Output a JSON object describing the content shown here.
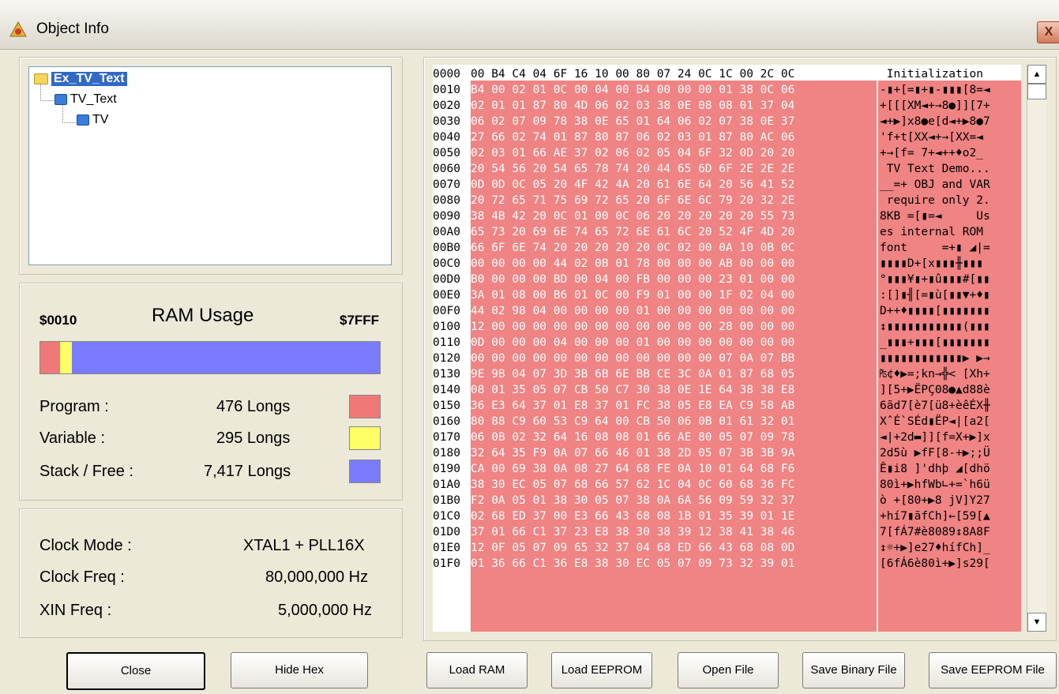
{
  "window": {
    "title": "Object Info",
    "close_glyph": "X"
  },
  "tree": {
    "items": [
      "Ex_TV_Text",
      "TV_Text",
      "TV"
    ]
  },
  "ram": {
    "low": "$0010",
    "title": "RAM Usage",
    "high": "$7FFF",
    "rows": [
      {
        "label": "Program :",
        "value": "476 Longs",
        "color": "#f07878"
      },
      {
        "label": "Variable :",
        "value": "295 Longs",
        "color": "#ffff66"
      },
      {
        "label": "Stack / Free :",
        "value": "7,417 Longs",
        "color": "#7b7bff"
      }
    ],
    "bar_segments": [
      {
        "name": "program",
        "longs": 476,
        "color": "#f07878"
      },
      {
        "name": "variable",
        "longs": 295,
        "color": "#ffff66"
      },
      {
        "name": "stack-free",
        "longs": 7417,
        "color": "#7b7bff"
      }
    ]
  },
  "clock": {
    "rows": [
      {
        "label": "Clock Mode :",
        "value": "XTAL1 + PLL16X"
      },
      {
        "label": "Clock Freq :",
        "value": "80,000,000 Hz"
      },
      {
        "label": "XIN Freq :",
        "value": "5,000,000 Hz"
      }
    ]
  },
  "buttons": {
    "close": "Close",
    "hide_hex": "Hide Hex",
    "load_ram": "Load RAM",
    "load_eeprom": "Load EEPROM",
    "open_file": "Open File",
    "save_binary": "Save Binary File",
    "save_eeprom": "Save EEPROM File"
  },
  "hex": {
    "rows": [
      {
        "addr": "0000",
        "hex": "00 B4 C4 04 6F 16 10 00 80 07 24 0C 1C 00 2C 0C",
        "ascii": " Initialization"
      },
      {
        "addr": "0010",
        "hex": "B4 00 02 01 0C 00 04 00 B4 00 00 00 01 38 0C 06",
        "ascii": "-▮+[=▮+▮-▮▮▮[8=◄"
      },
      {
        "addr": "0020",
        "hex": "02 01 01 87 80 4D 06 02 03 38 0E 08 08 01 37 04",
        "ascii": "+[[[XM◄+→8●]][7+"
      },
      {
        "addr": "0030",
        "hex": "06 02 07 09 78 38 0E 65 01 64 06 02 07 38 0E 37",
        "ascii": "◄+▶]x8●e[d◄+▶8●7"
      },
      {
        "addr": "0040",
        "hex": "27 66 02 74 01 87 80 87 06 02 03 01 87 80 AC 06",
        "ascii": "'f+t[XX◄+→[XX=◄"
      },
      {
        "addr": "0050",
        "hex": "02 03 01 66 AE 37 02 06 02 05 04 6F 32 0D 20 20",
        "ascii": "+→[f= 7+◄++♦o2_"
      },
      {
        "addr": "0060",
        "hex": "20 54 56 20 54 65 78 74 20 44 65 6D 6F 2E 2E 2E",
        "ascii": " TV Text Demo..."
      },
      {
        "addr": "0070",
        "hex": "0D 0D 0C 05 20 4F 42 4A 20 61 6E 64 20 56 41 52",
        "ascii": "__=+ OBJ and VAR"
      },
      {
        "addr": "0080",
        "hex": "20 72 65 71 75 69 72 65 20 6F 6E 6C 79 20 32 2E",
        "ascii": " require only 2."
      },
      {
        "addr": "0090",
        "hex": "38 4B 42 20 0C 01 00 0C 06 20 20 20 20 20 55 73",
        "ascii": "8KB =[▮=◄     Us"
      },
      {
        "addr": "00A0",
        "hex": "65 73 20 69 6E 74 65 72 6E 61 6C 20 52 4F 4D 20",
        "ascii": "es internal ROM "
      },
      {
        "addr": "00B0",
        "hex": "66 6F 6E 74 20 20 20 20 20 0C 02 00 0A 10 0B 0C",
        "ascii": "font     =+▮ ◢|="
      },
      {
        "addr": "00C0",
        "hex": "00 00 00 00 44 02 0B 01 78 00 00 00 AB 00 00 00",
        "ascii": "▮▮▮▮D+[x▮▮▮╫▮▮▮"
      },
      {
        "addr": "00D0",
        "hex": "B0 00 00 00 BD 00 04 00 FB 00 00 00 23 01 00 00",
        "ascii": "°▮▮▮¥▮+▮û▮▮▮#[▮▮"
      },
      {
        "addr": "00E0",
        "hex": "3A 01 08 00 B6 01 0C 00 F9 01 00 00 1F 02 04 00",
        "ascii": ":[]▮╢[=▮ù[▮▮▼+♦▮"
      },
      {
        "addr": "00F0",
        "hex": "44 02 98 04 00 00 00 00 01 00 00 00 00 00 00 00",
        "ascii": "D++♦▮▮▮▮[▮▮▮▮▮▮▮"
      },
      {
        "addr": "0100",
        "hex": "12 00 00 00 00 00 00 00 00 00 00 00 28 00 00 00",
        "ascii": "↕▮▮▮▮▮▮▮▮▮▮▮(▮▮▮"
      },
      {
        "addr": "0110",
        "hex": "0D 00 00 00 04 00 00 00 01 00 00 00 00 00 00 00",
        "ascii": "_▮▮▮+▮▮▮[▮▮▮▮▮▮▮"
      },
      {
        "addr": "0120",
        "hex": "00 00 00 00 00 00 00 00 00 00 00 00 07 0A 07 BB",
        "ascii": "▮▮▮▮▮▮▮▮▮▮▮▮▶ ▶→"
      },
      {
        "addr": "0130",
        "hex": "9E 9B 04 07 3D 3B 6B 6E BB CE 3C 0A 01 87 68 05",
        "ascii": "₧¢♦▶=;kn→╬< [Xh+"
      },
      {
        "addr": "0140",
        "hex": "08 01 35 05 07 CB 50 C7 30 38 0E 1E 64 38 38 E8",
        "ascii": "][5+▶ËPÇ08●▲d88è"
      },
      {
        "addr": "0150",
        "hex": "36 E3 64 37 01 E8 37 01 FC 38 05 E8 EA C9 58 AB",
        "ascii": "6ãd7[è7[ü8+èêÉX╫"
      },
      {
        "addr": "0160",
        "hex": "80 88 C9 60 53 C9 64 00 CB 50 06 0B 01 61 32 01",
        "ascii": "XˆÉ`SÉd▮ËP◄|[a2["
      },
      {
        "addr": "0170",
        "hex": "06 0B 02 32 64 16 08 08 01 66 AE 80 05 07 09 78",
        "ascii": "◄|+2d▬]][f=X+▶]x"
      },
      {
        "addr": "0180",
        "hex": "32 64 35 F9 0A 07 66 46 01 38 2D 05 07 3B 3B 9A",
        "ascii": "2d5ù ▶fF[8-+▶;;Ü"
      },
      {
        "addr": "0190",
        "hex": "CA 00 69 38 0A 08 27 64 68 FE 0A 10 01 64 68 F6",
        "ascii": "Ê▮i8 ]'dhþ ◢[dhö"
      },
      {
        "addr": "01A0",
        "hex": "38 30 EC 05 07 68 66 57 62 1C 04 0C 60 68 36 FC",
        "ascii": "80ì+▶hfWb∟+=`h6ü"
      },
      {
        "addr": "01B0",
        "hex": "F2 0A 05 01 38 30 05 07 38 0A 6A 56 09 59 32 37",
        "ascii": "ò +[80+▶8 jV]Y27"
      },
      {
        "addr": "01C0",
        "hex": "02 68 ED 37 00 E3 66 43 68 08 1B 01 35 39 01 1E",
        "ascii": "+hí7▮ãfCh]←[59[▲"
      },
      {
        "addr": "01D0",
        "hex": "37 01 66 C1 37 23 E8 38 30 38 39 12 38 41 38 46",
        "ascii": "7[fÁ7#è8089↕8A8F"
      },
      {
        "addr": "01E0",
        "hex": "12 0F 05 07 09 65 32 37 04 68 ED 66 43 68 08 0D",
        "ascii": "↕☼+▶]e27♦hífCh]_"
      },
      {
        "addr": "01F0",
        "hex": "01 36 66 C1 36 E8 38 30 EC 05 07 09 73 32 39 01",
        "ascii": "[6fÁ6è80ì+▶]s29["
      }
    ],
    "highlight_color": "#f08383"
  }
}
